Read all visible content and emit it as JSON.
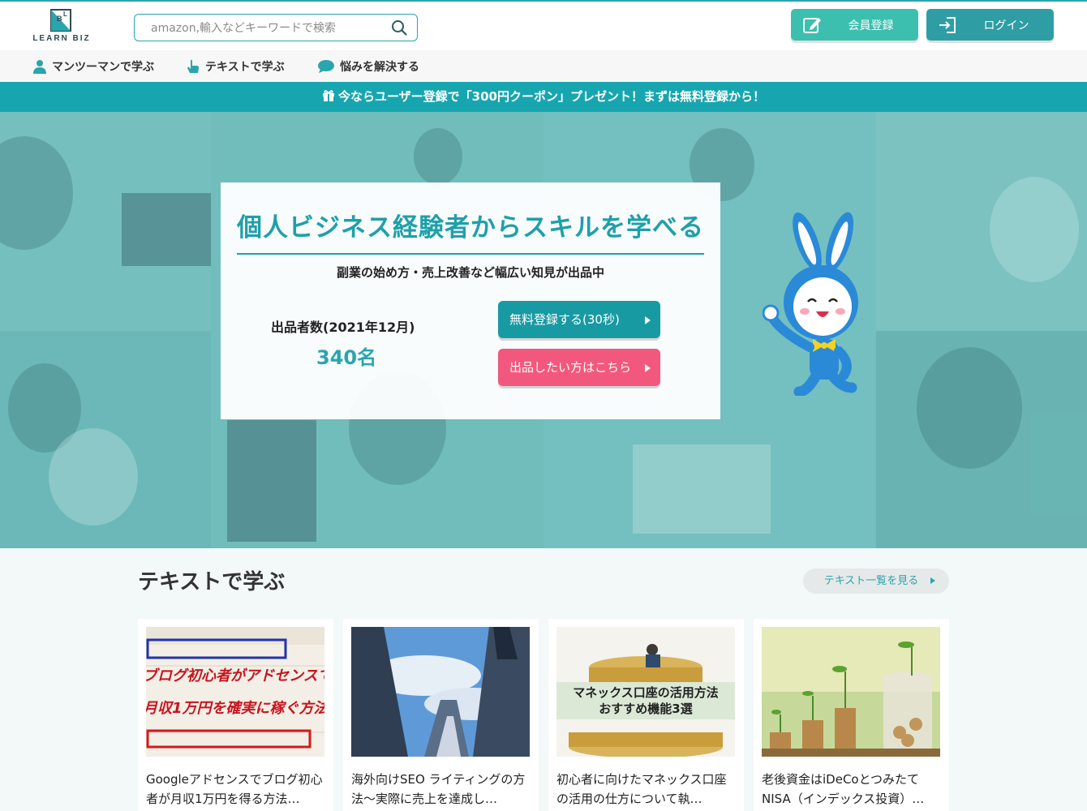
{
  "brand": {
    "logo_text": "LEARN BIZ",
    "accent": "#2aa5ad"
  },
  "search": {
    "placeholder": "amazon,輸入などキーワードで検索"
  },
  "header": {
    "register_label": "会員登録",
    "login_label": "ログイン"
  },
  "nav": {
    "items": [
      {
        "label": "マンツーマンで学ぶ",
        "icon": "person-icon"
      },
      {
        "label": "テキストで学ぶ",
        "icon": "hand-pointer-icon"
      },
      {
        "label": "悩みを解決する",
        "icon": "chat-bubble-icon"
      }
    ]
  },
  "banner": {
    "text": "今ならユーザー登録で「300円クーポン」プレゼント！まずは無料登録から！",
    "icon": "gift-icon"
  },
  "hero": {
    "title": "個人ビジネス経験者からスキルを学べる",
    "subtitle": "副業の始め方・売上改善など幅広い知見が出品中",
    "stat_label": "出品者数(2021年12月)",
    "stat_value": "340名",
    "cta_free": "無料登録する(30秒)",
    "cta_sell": "出品したい方はこちら"
  },
  "section": {
    "title": "テキストで学ぶ",
    "more_label": "テキスト一覧を見る",
    "articles": [
      {
        "title": "Googleアドセンスでブログ初心者が月収1万円を得る方法…",
        "thumb_text_1": "ブログ初心者がアドセンスで",
        "thumb_text_2": "月収1万円を確実に稼ぐ方法"
      },
      {
        "title": "海外向けSEO ライティングの方法〜実際に売上を達成し…"
      },
      {
        "title": "初心者に向けたマネックス口座の活用の仕方について執…",
        "thumb_text_1": "マネックス口座の活用方法",
        "thumb_text_2": "おすすめ機能3選"
      },
      {
        "title": "老後資金はiDeCoとつみたてNISA（インデックス投資）…"
      }
    ]
  },
  "colors": {
    "teal": "#2aa5ad",
    "banner": "#17a6b0",
    "register": "#3cbfaf",
    "login": "#2e9ea4",
    "pink": "#f2587e"
  }
}
